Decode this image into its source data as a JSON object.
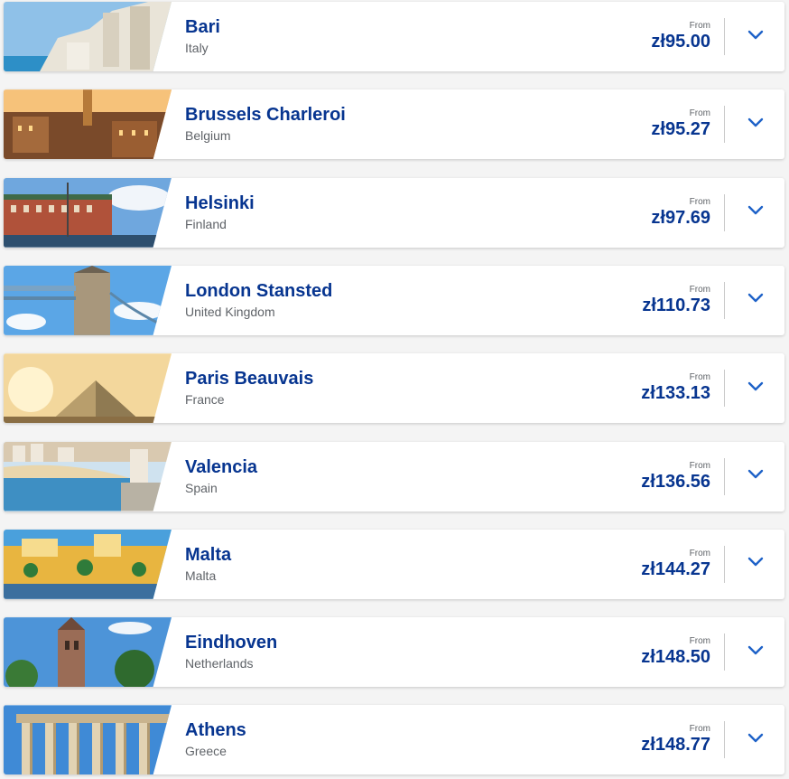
{
  "labels": {
    "from": "From"
  },
  "colors": {
    "brand": "#073590",
    "chevron": "#1e62c8",
    "muted": "#5f6368"
  },
  "icons": {
    "expand": "chevron-down-icon"
  },
  "destinations": [
    {
      "city": "Bari",
      "country": "Italy",
      "price": "zł95.00",
      "scene": "coast-whitewash"
    },
    {
      "city": "Brussels Charleroi",
      "country": "Belgium",
      "price": "zł95.27",
      "scene": "grand-place"
    },
    {
      "city": "Helsinki",
      "country": "Finland",
      "price": "zł97.69",
      "scene": "harbour"
    },
    {
      "city": "London Stansted",
      "country": "United Kingdom",
      "price": "zł110.73",
      "scene": "tower-bridge"
    },
    {
      "city": "Paris Beauvais",
      "country": "France",
      "price": "zł133.13",
      "scene": "louvre-pyramid"
    },
    {
      "city": "Valencia",
      "country": "Spain",
      "price": "zł136.56",
      "scene": "beach"
    },
    {
      "city": "Malta",
      "country": "Malta",
      "price": "zł144.27",
      "scene": "yellow-town"
    },
    {
      "city": "Eindhoven",
      "country": "Netherlands",
      "price": "zł148.50",
      "scene": "church-tower"
    },
    {
      "city": "Athens",
      "country": "Greece",
      "price": "zł148.77",
      "scene": "parthenon"
    }
  ]
}
